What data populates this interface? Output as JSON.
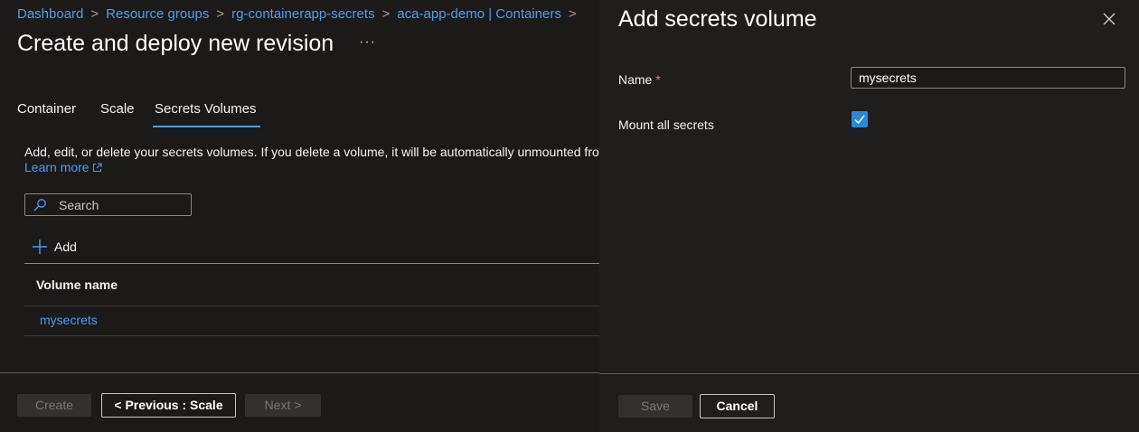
{
  "breadcrumb": [
    "Dashboard",
    "Resource groups",
    "rg-containerapp-secrets",
    "aca-app-demo | Containers"
  ],
  "page": {
    "title": "Create and deploy new revision",
    "more_glyph": "···"
  },
  "tabs": [
    {
      "label": "Container"
    },
    {
      "label": "Scale"
    },
    {
      "label": "Secrets Volumes",
      "active": true
    }
  ],
  "secrets": {
    "description": "Add, edit, or delete your secrets volumes. If you delete a volume, it will be automatically unmounted from yo",
    "learn_more": "Learn more",
    "search_placeholder": "Search",
    "add_label": "Add",
    "table": {
      "column_header": "Volume name",
      "rows": [
        {
          "name": "mysecrets"
        }
      ]
    }
  },
  "footer": {
    "create_label": "Create",
    "previous_label": "< Previous : Scale",
    "next_label": "Next >"
  },
  "panel": {
    "title": "Add secrets volume",
    "name_label": "Name",
    "required_mark": "*",
    "name_value": "mysecrets",
    "mount_label": "Mount all secrets",
    "mount_checked": true,
    "save_label": "Save",
    "cancel_label": "Cancel"
  },
  "colors": {
    "link": "#479ef5",
    "background": "#1b1a19",
    "checkbox": "#2b88d8"
  },
  "icons": [
    "chevron-right-icon",
    "more-icon",
    "external-link-icon",
    "search-icon",
    "plus-icon",
    "close-icon",
    "checkmark-icon"
  ]
}
